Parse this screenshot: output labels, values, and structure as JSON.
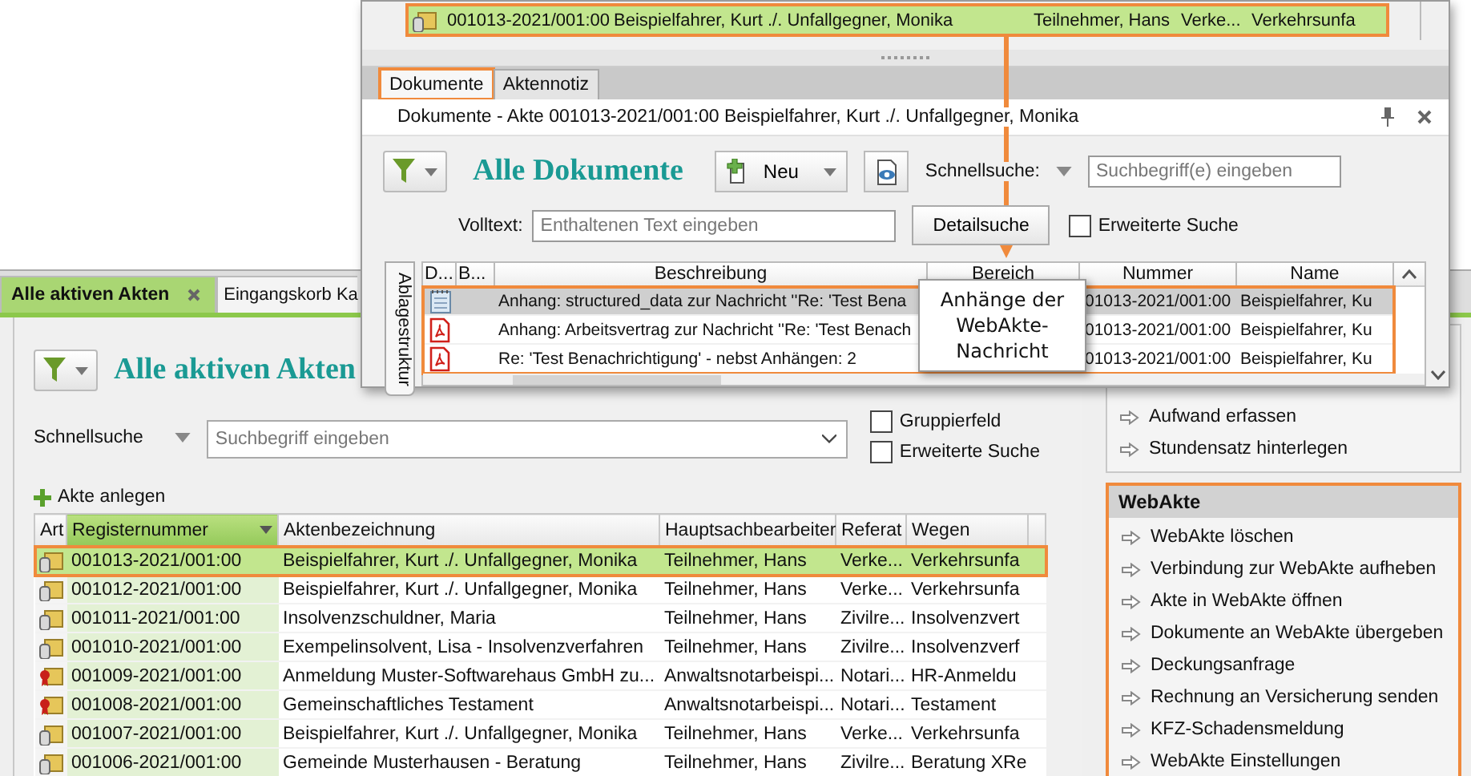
{
  "main_tabs": [
    {
      "label": "Alle aktiven Akten",
      "selected": true
    },
    {
      "label": "Eingangskorb Ka",
      "selected": false
    }
  ],
  "files_view": {
    "title": "Alle aktiven Akten",
    "quick_search": {
      "label": "Schnellsuche",
      "placeholder": "Suchbegriff eingeben"
    },
    "options": [
      {
        "label": "Gruppierfeld",
        "checked": false
      },
      {
        "label": "Erweiterte Suche",
        "checked": false
      }
    ],
    "add_action": "Akte anlegen",
    "table": {
      "columns": [
        {
          "label": "Art",
          "sorted": false
        },
        {
          "label": "Registernummer",
          "sorted": true
        },
        {
          "label": "Aktenbezeichnung",
          "sorted": false
        },
        {
          "label": "Hauptsachbearbeiter",
          "sorted": false
        },
        {
          "label": "Referat",
          "sorted": false
        },
        {
          "label": "Wegen",
          "sorted": false
        }
      ],
      "rows": [
        {
          "kind": "paragraph",
          "selected": true,
          "highlighted": true,
          "cells": [
            "",
            "001013-2021/001:00",
            "Beispielfahrer, Kurt ./. Unfallgegner, Monika",
            "Teilnehmer, Hans",
            "Verke...",
            "Verkehrsunfa"
          ]
        },
        {
          "kind": "paragraph",
          "selected": false,
          "highlighted": false,
          "cells": [
            "",
            "001012-2021/001:00",
            "Beispielfahrer, Kurt ./. Unfallgegner, Monika",
            "Teilnehmer, Hans",
            "Verke...",
            "Verkehrsunfa"
          ]
        },
        {
          "kind": "paragraph",
          "selected": false,
          "highlighted": false,
          "cells": [
            "",
            "001011-2021/001:00",
            "Insolvenzschuldner, Maria",
            "Teilnehmer, Hans",
            "Zivilre...",
            "Insolvenzvert"
          ]
        },
        {
          "kind": "paragraph",
          "selected": false,
          "highlighted": false,
          "cells": [
            "",
            "001010-2021/001:00",
            "Exempelinsolvent, Lisa - Insolvenzverfahren",
            "Teilnehmer, Hans",
            "Zivilre...",
            "Insolvenzverf"
          ]
        },
        {
          "kind": "seal",
          "selected": false,
          "highlighted": false,
          "cells": [
            "",
            "001009-2021/001:00",
            "Anmeldung Muster-Softwarehaus GmbH zu...",
            "Anwaltsnotarbeispi...",
            "Notari...",
            "HR-Anmeldu"
          ]
        },
        {
          "kind": "seal",
          "selected": false,
          "highlighted": false,
          "cells": [
            "",
            "001008-2021/001:00",
            "Gemeinschaftliches Testament",
            "Anwaltsnotarbeispi...",
            "Notari...",
            "Testament"
          ]
        },
        {
          "kind": "paragraph",
          "selected": false,
          "highlighted": false,
          "cells": [
            "",
            "001007-2021/001:00",
            "Beispielfahrer, Kurt ./. Unfallgegner, Monika",
            "Teilnehmer, Hans",
            "Verke...",
            "Verkehrsunfa"
          ]
        },
        {
          "kind": "paragraph",
          "selected": false,
          "highlighted": false,
          "cells": [
            "",
            "001006-2021/001:00",
            "Gemeinde Musterhausen - Beratung",
            "Teilnehmer, Hans",
            "Zivilre...",
            "Beratung XRe"
          ]
        }
      ]
    }
  },
  "task_pane": {
    "actions": [
      "Aufwand erfassen",
      "Stundensatz hinterlegen"
    ],
    "webakte": {
      "title": "WebAkte",
      "highlighted": true,
      "items": [
        "WebAkte löschen",
        "Verbindung zur WebAkte aufheben",
        "Akte in WebAkte öffnen",
        "Dokumente an WebAkte übergeben",
        "Deckungsanfrage",
        "Rechnung an Versicherung senden",
        "KFZ-Schadensmeldung",
        "WebAkte Einstellungen"
      ]
    }
  },
  "documents_window": {
    "file_row": {
      "kind": "paragraph",
      "selected": true,
      "highlighted": true,
      "cells": [
        "001013-2021/001:00",
        "Beispielfahrer, Kurt ./. Unfallgegner, Monika",
        "Teilnehmer, Hans",
        "Verke...",
        "Verkehrsunfa"
      ]
    },
    "tabs": [
      {
        "label": "Dokumente",
        "selected": true,
        "highlighted": true
      },
      {
        "label": "Aktennotiz",
        "selected": false,
        "highlighted": false
      }
    ],
    "caption": "Dokumente - Akte 001013-2021/001:00 Beispielfahrer, Kurt ./. Unfallgegner, Monika",
    "title": "Alle Dokumente",
    "new_button": "Neu",
    "quick_search": {
      "label": "Schnellsuche:",
      "placeholder": "Suchbegriff(e) eingeben"
    },
    "fulltext": {
      "label": "Volltext:",
      "placeholder": "Enthaltenen Text eingeben"
    },
    "detail_button": "Detailsuche",
    "extended_search": {
      "label": "Erweiterte Suche",
      "checked": false
    },
    "side_tab": "Ablagestruktur",
    "table": {
      "highlighted": true,
      "columns": [
        "D...",
        "B...",
        "Beschreibung",
        "Bereich",
        "Nummer",
        "Name"
      ],
      "rows": [
        {
          "kind": "text",
          "selected": true,
          "description": "Anhang: structured_data zur Nachricht ''Re: 'Test Bena",
          "number": "01013-2021/001:00",
          "name": "Beispielfahrer, Ku"
        },
        {
          "kind": "pdf",
          "selected": false,
          "description": "Anhang: Arbeitsvertrag zur Nachricht ''Re: 'Test Benach",
          "number": "01013-2021/001:00",
          "name": "Beispielfahrer, Ku"
        },
        {
          "kind": "pdf",
          "selected": false,
          "description": "Re: 'Test Benachrichtigung' - nebst Anhängen: 2",
          "number": "01013-2021/001:00",
          "name": "Beispielfahrer, Ku"
        }
      ]
    }
  },
  "callout": "Anhänge der WebAkte-Nachricht"
}
